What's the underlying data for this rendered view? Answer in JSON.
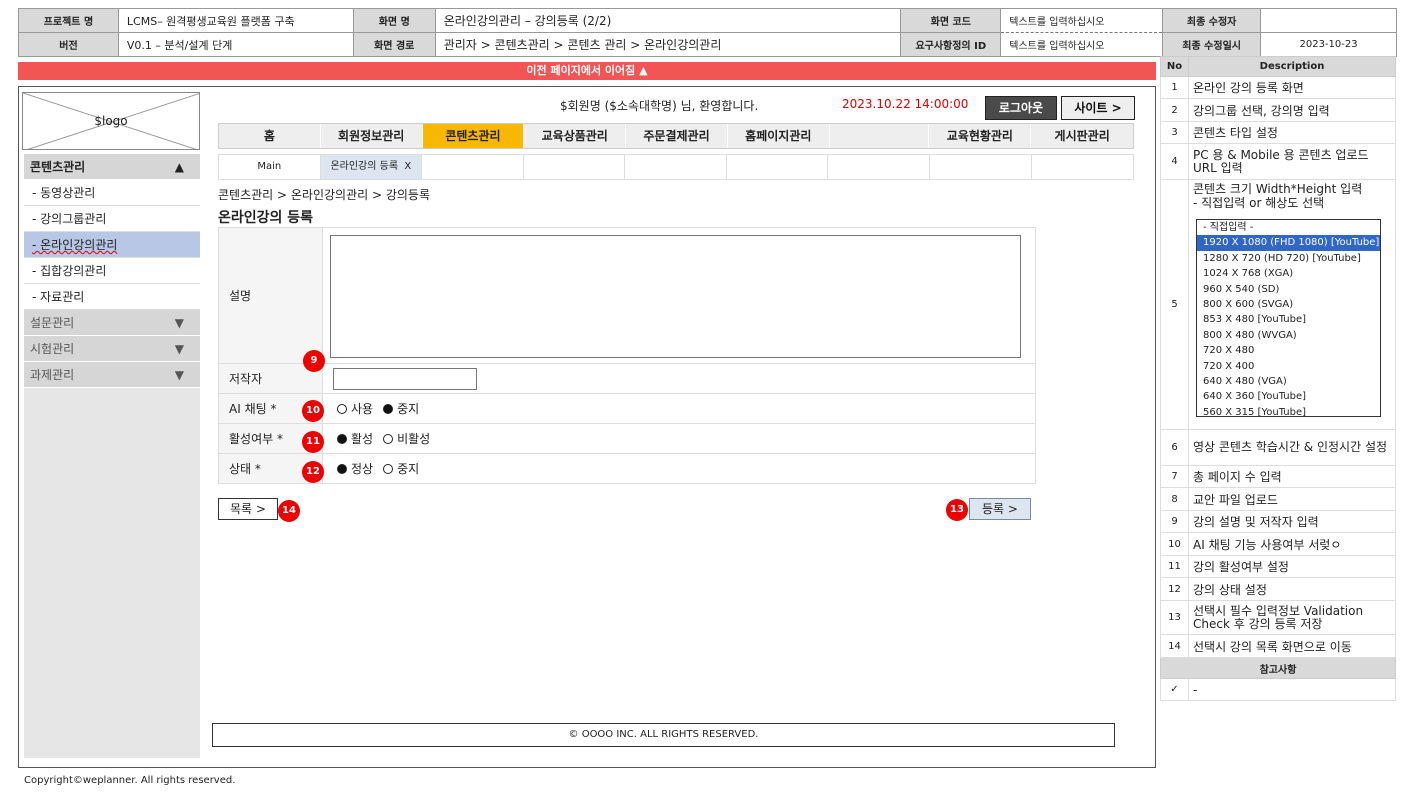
{
  "header": {
    "project_label": "프로젝트 명",
    "project_value": "LCMS– 원격평생교육원 플랫폼 구축",
    "screen_name_label": "화면 명",
    "screen_name_value": "온라인강의관리 – 강의등록 (2/2)",
    "screen_code_label": "화면 코드",
    "screen_code_value": "텍스트를 입력하십시오",
    "last_editor_label": "최종 수정자",
    "last_editor_value": "",
    "version_label": "버전",
    "version_value": "V0.1 – 분석/설계 단계",
    "screen_path_label": "화면 경로",
    "screen_path_value": "관리자 > 콘텐츠관리 > 콘텐츠 관리 > 온라인강의관리",
    "req_id_label": "요구사항정의 ID",
    "req_id_value": "텍스트를 입력하십시오",
    "last_date_label": "최종 수정일시",
    "last_date_value": "2023-10-23"
  },
  "banner": "이전 페이지에서 이어짐 ▲",
  "logo": "$logo",
  "welcome": "$회원명 ($소속대학명) 님, 환영합니다.",
  "datetime": "2023.10.22  14:00:00",
  "logout": "로그아웃",
  "site": "사이트 >",
  "nav": [
    "홈",
    "회원정보관리",
    "콘텐츠관리",
    "교육상품관리",
    "주문결제관리",
    "홈페이지관리",
    "",
    "교육현황관리",
    "게시판관리"
  ],
  "tabs": {
    "main": "Main",
    "active": "온라인강의 등록",
    "close": "X"
  },
  "sidebar": {
    "group": "콘텐츠관리",
    "group_arrow": "▲",
    "items": [
      "- 동영상관리",
      "- 강의그룹관리",
      "- 온라인강의관리",
      "- 집합강의관리",
      "- 자료관리"
    ],
    "collapsed": [
      "설문관리",
      "시험관리",
      "과제관리"
    ],
    "collapsed_arrow": "▼"
  },
  "breadcrumb": "콘텐츠관리 > 온라인강의관리 > 강의등록",
  "page_title": "온라인강의 등록",
  "form": {
    "desc_label": "설명",
    "author_label": "저작자",
    "ai_label": "AI 채팅 *",
    "ai_opts": [
      "사용",
      "중지"
    ],
    "active_label": "활성여부 *",
    "active_opts": [
      "활성",
      "비활성"
    ],
    "status_label": "상태 *",
    "status_opts": [
      "정상",
      "중지"
    ]
  },
  "badges": {
    "b9": "9",
    "b10": "10",
    "b11": "11",
    "b12": "12",
    "b13": "13",
    "b14": "14"
  },
  "list_btn": "목록 >",
  "reg_btn": "등록 >",
  "footer": "© OOOO INC. ALL RIGHTS RESERVED.",
  "copyright": "Copyright©weplanner. All rights reserved.",
  "right_panel": {
    "no_header": "No",
    "desc_header": "Description",
    "rows": [
      {
        "no": "1",
        "text": "온라인 강의 등록 화면"
      },
      {
        "no": "2",
        "text": "강의그룹 선택, 강의명 입력"
      },
      {
        "no": "3",
        "text": "콘텐츠 타입 설정"
      },
      {
        "no": "4",
        "text": "PC 용 & Mobile 용 콘텐츠 업로드 URL 입력"
      },
      {
        "no": "5",
        "text": "콘텐츠 크기 Width*Height 입력\n- 직접입력 or 해상도 선택"
      },
      {
        "no": "6",
        "text": "영상 콘텐츠 학습시간 & 인정시간 설정"
      },
      {
        "no": "7",
        "text": "총 페이지 수 입력"
      },
      {
        "no": "8",
        "text": "교안 파일 업로드"
      },
      {
        "no": "9",
        "text": "강의 설명 및 저작자 입력"
      },
      {
        "no": "10",
        "text": "AI 채팅 기능 사용여부 서렂ㅇ"
      },
      {
        "no": "11",
        "text": "강의 활성여부 설정"
      },
      {
        "no": "12",
        "text": "강의 상태 설정"
      },
      {
        "no": "13",
        "text": "선택시 필수 입력정보 Validation Check 후 강의 등록 저장"
      },
      {
        "no": "14",
        "text": "선택시 강의 목록 화면으로 이동"
      }
    ],
    "resolutions": [
      "- 직접입력 -",
      "1920 X 1080 (FHD 1080) [YouTube]",
      "1280 X 720 (HD 720) [YouTube]",
      "1024 X 768 (XGA)",
      "960 X 540 (SD)",
      "800 X 600 (SVGA)",
      "853 X 480 [YouTube]",
      "800 X 480 (WVGA)",
      "720 X 480",
      "720 X 400",
      "640 X 480 (VGA)",
      "640 X 360 [YouTube]",
      "560 X 315 [YouTube]"
    ],
    "notes_header": "참고사항",
    "note_check": "✓",
    "note_text": "-"
  }
}
